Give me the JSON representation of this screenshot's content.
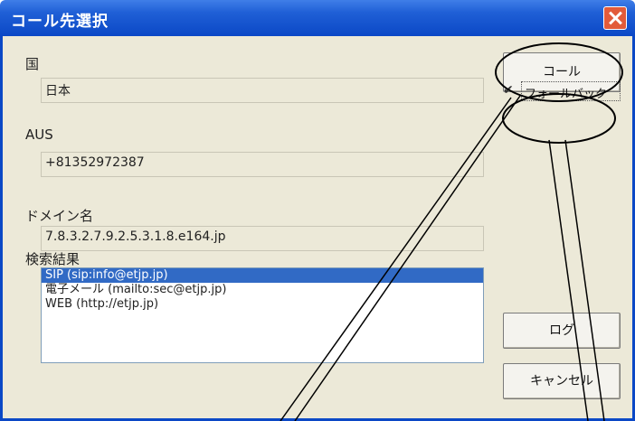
{
  "window": {
    "title": "コール先選択"
  },
  "fields": {
    "country": {
      "label": "国",
      "value": "日本"
    },
    "aus": {
      "label": "AUS",
      "value": "+81352972387"
    },
    "domain": {
      "label": "ドメイン名",
      "value": "7.8.3.2.7.9.2.5.3.1.8.e164.jp"
    }
  },
  "results": {
    "label": "検索結果",
    "items": [
      "SIP (sip:info@etjp.jp)",
      "電子メール (mailto:sec@etjp.jp)",
      "WEB (http://etjp.jp)"
    ],
    "selected_index": 0
  },
  "buttons": {
    "call": "コール",
    "fallback": "フォールバック",
    "log": "ログ",
    "cancel": "キャンセル"
  },
  "fallback_checked": true
}
